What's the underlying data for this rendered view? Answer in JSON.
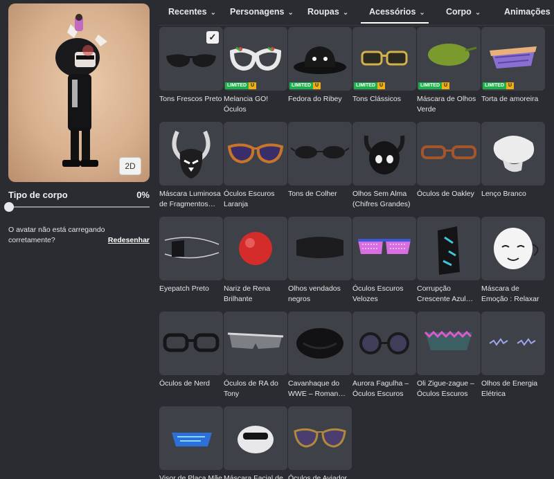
{
  "left_panel": {
    "view_button": "2D",
    "body_type_label": "Tipo de corpo",
    "body_type_value": "0%",
    "body_type_fraction": 0,
    "help_text": "O avatar não está carregando corretamente?",
    "redraw_link": "Redesenhar"
  },
  "tabs": [
    {
      "label": "Recentes",
      "dropdown": false
    },
    {
      "label": "Personagens",
      "dropdown": true
    },
    {
      "label": "Roupas",
      "dropdown": true
    },
    {
      "label": "Acessórios",
      "dropdown": true,
      "active": true
    },
    {
      "label": "Corpo",
      "dropdown": true
    },
    {
      "label": "Animações",
      "dropdown": true
    }
  ],
  "badge": {
    "limited": "LIMITED",
    "u": "U"
  },
  "items": [
    {
      "name": "Tons Frescos Preto",
      "icon": "black-sunglasses",
      "selected": true,
      "limited": false
    },
    {
      "name": "Melancia GO! Óculos",
      "icon": "watermelon-glasses",
      "limited": true
    },
    {
      "name": "Fedora do Ribey",
      "icon": "black-fedora",
      "limited": true
    },
    {
      "name": "Tons Clássicos",
      "icon": "gold-sunglasses",
      "limited": true
    },
    {
      "name": "Máscara de Olhos Verde",
      "icon": "green-eyepatch",
      "limited": true
    },
    {
      "name": "Torta de amoreira",
      "icon": "blackberry-pie",
      "limited": true
    },
    {
      "name": "Máscara Luminosa de Fragmentos…",
      "icon": "horned-mask",
      "limited": false
    },
    {
      "name": "Óculos Escuros Laranja",
      "icon": "orange-sunglasses",
      "limited": false
    },
    {
      "name": "Tons de Colher",
      "icon": "spoon-shades",
      "limited": false
    },
    {
      "name": "Olhos Sem Alma (Chifres Grandes)",
      "icon": "horned-skull",
      "limited": false
    },
    {
      "name": "Óculos de Oakley",
      "icon": "oakley-glasses",
      "limited": false
    },
    {
      "name": "Lenço Branco",
      "icon": "white-scarf",
      "limited": false
    },
    {
      "name": "Eyepatch Preto",
      "icon": "black-eyepatch",
      "limited": false
    },
    {
      "name": "Nariz de Rena Brilhante",
      "icon": "red-nose",
      "limited": false
    },
    {
      "name": "Olhos vendados negros",
      "icon": "blindfold",
      "limited": false
    },
    {
      "name": "Óculos Escuros Velozes",
      "icon": "speed-glasses",
      "limited": false
    },
    {
      "name": "Corrupção Crescente Azul…",
      "icon": "corruption-mask",
      "limited": false
    },
    {
      "name": "Máscara de Emoção : Relaxar",
      "icon": "relax-mask",
      "limited": false
    },
    {
      "name": "Óculos de Nerd",
      "icon": "nerd-glasses",
      "limited": false
    },
    {
      "name": "Óculos de RA do Tony",
      "icon": "ar-glasses",
      "limited": false
    },
    {
      "name": "Cavanhaque do WWE – Roman…",
      "icon": "goatee",
      "limited": false
    },
    {
      "name": "Aurora Fagulha – Óculos Escuros",
      "icon": "round-shades",
      "limited": false
    },
    {
      "name": "Oli Zigue-zague – Óculos Escuros",
      "icon": "zigzag-shades",
      "limited": false
    },
    {
      "name": "Olhos de Energia Elétrica",
      "icon": "electric-eyes",
      "limited": false
    },
    {
      "name": "Visor de Placa Mãe",
      "icon": "circuit-visor",
      "limited": false
    },
    {
      "name": "Máscara Facial de",
      "icon": "face-mask",
      "limited": false
    },
    {
      "name": "Óculos de Aviador",
      "icon": "aviator-glasses",
      "limited": false
    }
  ]
}
